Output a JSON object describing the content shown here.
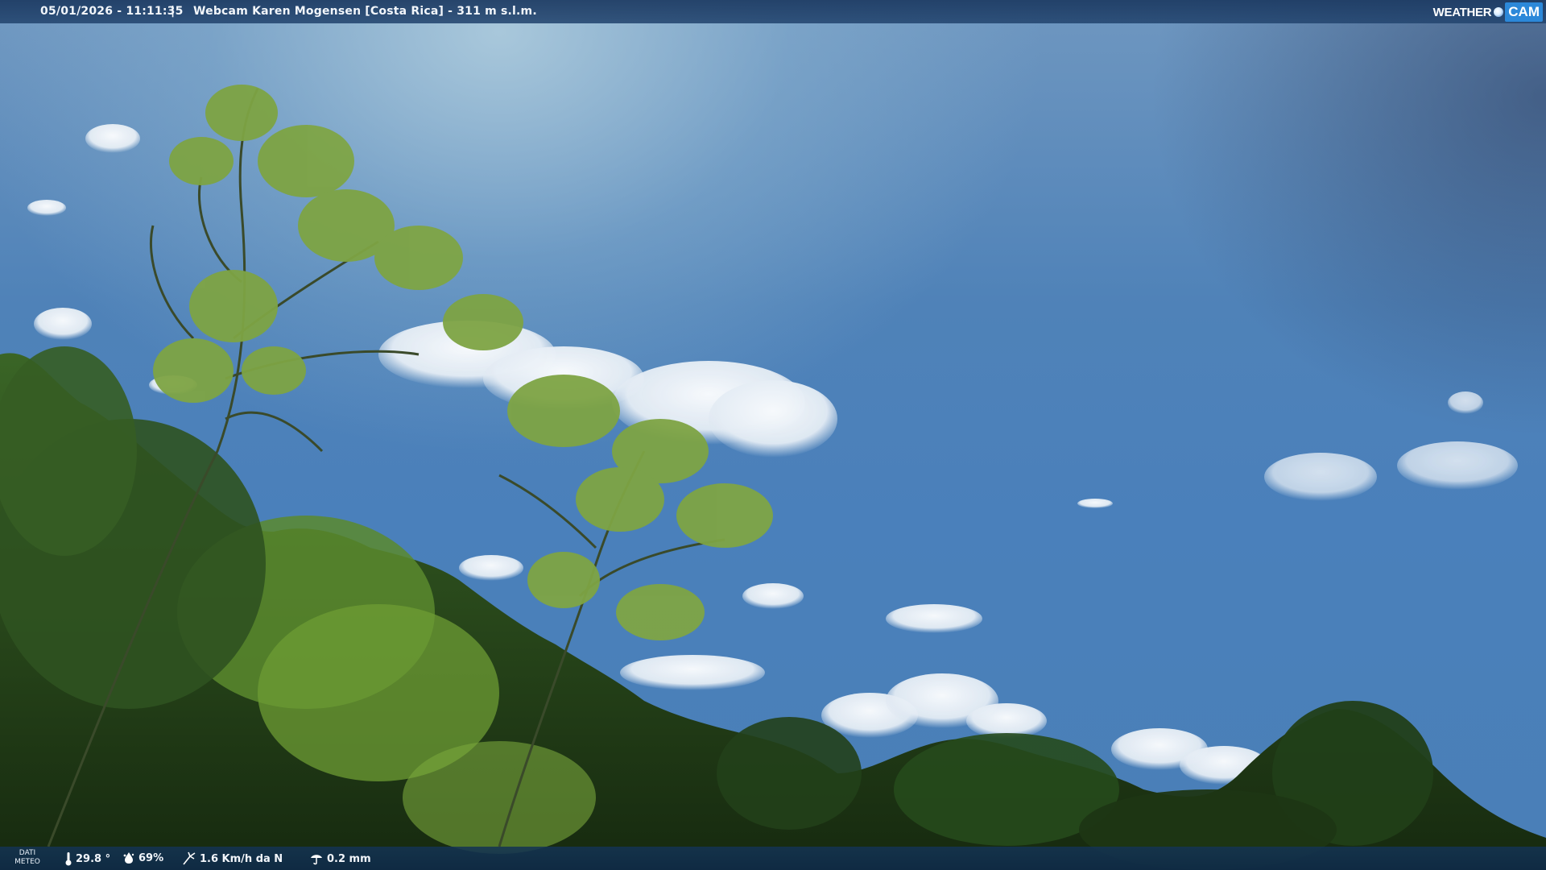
{
  "top_bar": {
    "datetime": "05/01/2026 - 11:11:35",
    "separator": "|",
    "title": "Webcam Karen Mogensen [Costa Rica] - 311 m s.l.m."
  },
  "brand": {
    "weather": "WEATHER",
    "cam": "CAM"
  },
  "bottom_bar": {
    "label": "DATI METEO",
    "temperature": "29.8 °",
    "humidity": "69%",
    "wind": "1.6 Km/h da N",
    "rain": "0.2 mm"
  },
  "icons": {
    "temperature": "thermometer-icon",
    "humidity": "humidity-icon",
    "wind": "wind-icon",
    "rain": "rain-icon"
  },
  "colors": {
    "bar_bg": "#1c3a62",
    "brand_cam": "#2c88d9",
    "sky": "#4a80bb",
    "foliage_dark": "#1f3a1c",
    "foliage_light": "#7fa63a"
  }
}
